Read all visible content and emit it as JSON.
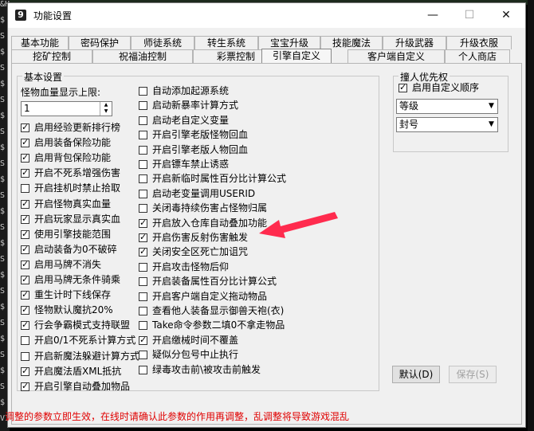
{
  "window": {
    "title": "功能设置"
  },
  "tabs_row1": [
    "基本功能",
    "密码保护",
    "师徒系统",
    "转生系统",
    "宝宝升级",
    "技能魔法",
    "升级武器",
    "升级衣服"
  ],
  "tabs_row2": [
    "挖矿控制",
    "祝福油控制",
    "彩票控制",
    "引擎自定义",
    "客户端自定义",
    "个人商店"
  ],
  "active_tab": "引擎自定义",
  "basic": {
    "group_title": "基本设置",
    "monster_limit_label": "怪物血量显示上限:",
    "monster_limit_value": "1",
    "left_checks": [
      {
        "label": "启用经验更新排行榜",
        "checked": true
      },
      {
        "label": "启用装备保险功能",
        "checked": true
      },
      {
        "label": "启用背包保险功能",
        "checked": true
      },
      {
        "label": "开启不死系增强伤害",
        "checked": true
      },
      {
        "label": "开启挂机时禁止拾取",
        "checked": false
      },
      {
        "label": "开启怪物真实血量",
        "checked": true
      },
      {
        "label": "开启玩家显示真实血",
        "checked": true
      },
      {
        "label": "使用引擎技能范围",
        "checked": true
      },
      {
        "label": "启动装备为0不破碎",
        "checked": true
      },
      {
        "label": "启用马牌不消失",
        "checked": true
      },
      {
        "label": "启用马牌无条件骑乘",
        "checked": true
      },
      {
        "label": "重生计时下线保存",
        "checked": true
      },
      {
        "label": "怪物默认魔抗20%",
        "checked": true
      },
      {
        "label": "行会争霸模式支持联盟",
        "checked": true
      },
      {
        "label": "开启0/1不死系计算方式",
        "checked": false
      },
      {
        "label": "开启新魔法躲避计算方式",
        "checked": false
      },
      {
        "label": "开启魔法盾XML抵抗",
        "checked": true
      },
      {
        "label": "开启引擎自动叠加物品",
        "checked": true
      }
    ],
    "right_checks": [
      {
        "label": "自动添加起源系统",
        "checked": false
      },
      {
        "label": "启动新暴率计算方式",
        "checked": false
      },
      {
        "label": "启动老自定义变量",
        "checked": false
      },
      {
        "label": "开启引擎老版怪物回血",
        "checked": false
      },
      {
        "label": "开启引擎老版人物回血",
        "checked": false
      },
      {
        "label": "开启镖车禁止诱惑",
        "checked": false
      },
      {
        "label": "开启新临时属性百分比计算公式",
        "checked": false
      },
      {
        "label": "启动老变量调用USERID",
        "checked": false
      },
      {
        "label": "关闭毒持续伤害占怪物归属",
        "checked": false
      },
      {
        "label": "开启放入仓库自动叠加功能",
        "checked": true
      },
      {
        "label": "开启伤害反射伤害触发",
        "checked": true
      },
      {
        "label": "关闭安全区死亡加诅咒",
        "checked": true
      },
      {
        "label": "开启攻击怪物后仰",
        "checked": false
      },
      {
        "label": "开启装备属性百分比计算公式",
        "checked": false
      },
      {
        "label": "开启客户端自定义拖动物品",
        "checked": false
      },
      {
        "label": "查看他人装备显示御兽天袍(衣)",
        "checked": false
      },
      {
        "label": "Take命令参数二填0不拿走物品",
        "checked": false
      },
      {
        "label": "开启缴械时间不覆盖",
        "checked": true
      },
      {
        "label": "疑似分包号中止执行",
        "checked": false
      },
      {
        "label": "绿毒攻击前\\被攻击前触发",
        "checked": false
      }
    ]
  },
  "priority": {
    "group_title": "撞人优先权",
    "enable_label": "启用自定义顺序",
    "enable_checked": true,
    "select1": "等级",
    "select2": "封号"
  },
  "buttons": {
    "default": "默认(D)",
    "save": "保存(S)"
  },
  "footer_note": "调整的参数立即生效，在线时请确认此参数的作用再调整，乱调整将导致游戏混乱",
  "background": {
    "left_text": [
      "&HUM",
      "$",
      "S",
      "$",
      "S",
      "$",
      "S",
      "$",
      "S",
      "$",
      "S",
      "$",
      "S",
      "$",
      "S",
      "$",
      "S",
      "$",
      "S",
      "$",
      "S",
      "$",
      "S",
      "$",
      "S",
      "$",
      "VISIO"
    ]
  },
  "colors": {
    "warning": "#e00000",
    "annotation_arrow": "#ff2b4e"
  }
}
